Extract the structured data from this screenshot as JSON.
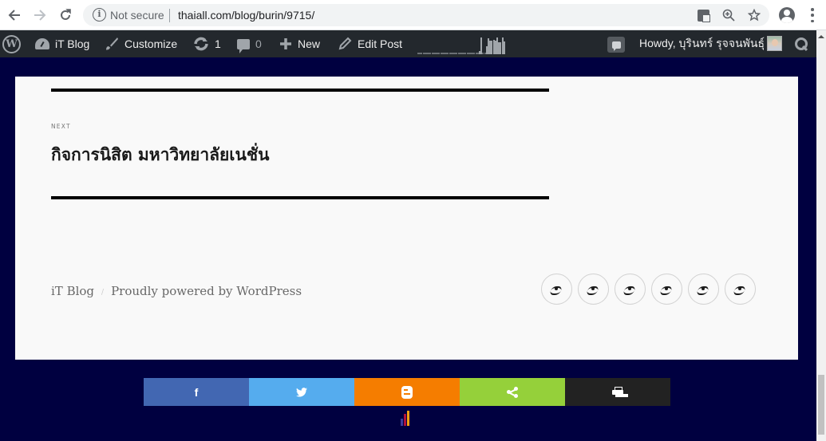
{
  "browser": {
    "back_icon": "arrow-left-icon",
    "forward_icon": "arrow-right-icon",
    "reload_icon": "reload-icon",
    "security_label": "Not secure",
    "url": "thaiall.com/blog/burin/9715/",
    "actions": [
      "translate-icon",
      "zoom-icon",
      "star-icon",
      "profile-icon",
      "menu-icon"
    ]
  },
  "adminbar": {
    "wp_logo": "wordpress-logo-icon",
    "site_name": "iT Blog",
    "customize": "Customize",
    "updates_count": "1",
    "comments_count": "0",
    "new_label": "New",
    "edit_post": "Edit Post",
    "howdy": "Howdy, บุรินทร์ รุจจนพันธุ์",
    "sparkline_values": [
      0.1,
      0.1,
      0.1,
      0.1,
      0.1,
      0.1,
      0.1,
      0.1,
      0.1,
      0.1,
      0.1,
      0.1,
      0.1,
      0.1,
      0.1,
      0.1,
      0.1,
      0.1,
      0.1,
      0.1,
      0.1,
      0.1,
      0.1,
      0.1,
      0.1,
      0.1,
      0.1,
      0.1,
      0.1,
      0.1,
      0.1,
      0.1,
      0.1,
      0.1,
      0.1,
      0.2,
      1.0,
      0.1,
      0.1,
      0.5,
      0.95,
      0.8,
      0.8,
      0.85,
      0.8,
      1.0,
      0.7,
      0.7,
      1.0,
      0.75
    ]
  },
  "post_nav": {
    "next_label": "Next",
    "next_title": "กิจการนิสิต มหาวิทยาลัยเนชั่น"
  },
  "footer": {
    "site_title": "iT Blog",
    "separator": "/",
    "powered_by": "Proudly powered by WordPress",
    "social_links": [
      "social-link-1",
      "social-link-2",
      "social-link-3",
      "social-link-4",
      "social-link-5",
      "social-link-6"
    ]
  },
  "share_bar": [
    {
      "name": "facebook",
      "glyph": "f",
      "color": "#4267b2"
    },
    {
      "name": "twitter",
      "glyph": "🐦",
      "color": "#55acee"
    },
    {
      "name": "blogger",
      "glyph": "",
      "color": "#f57d00"
    },
    {
      "name": "share",
      "glyph": "",
      "color": "#95d03a"
    },
    {
      "name": "print",
      "glyph": "",
      "color": "#222222"
    }
  ],
  "colors": {
    "page_bg": "#000040",
    "adminbar_bg": "#23282d",
    "card_bg": "#f9f9f9"
  }
}
